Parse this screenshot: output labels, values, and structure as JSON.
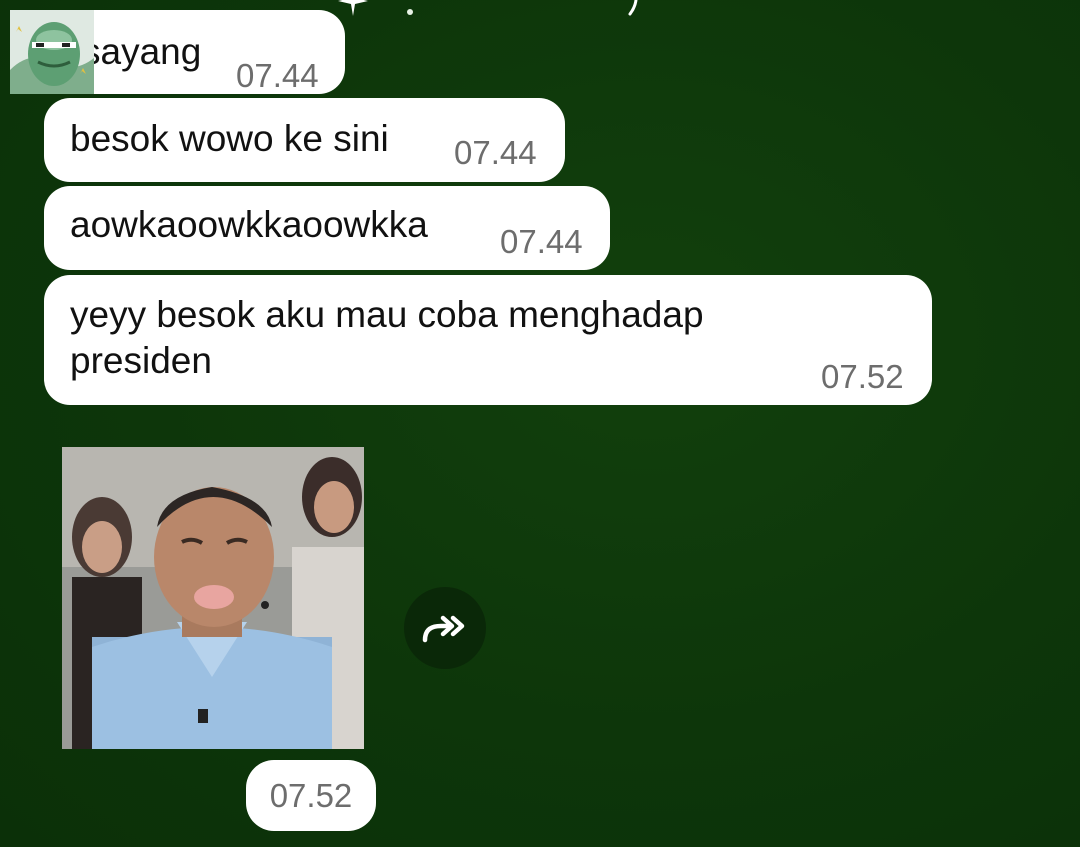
{
  "messages": [
    {
      "text": "sayang",
      "time": "07.44"
    },
    {
      "text": "besok wowo ke sini",
      "time": "07.44"
    },
    {
      "text": "aowkaoowkkaoowkka",
      "time": "07.44"
    },
    {
      "text": "yeyy besok aku mau coba menghadap presiden",
      "time": "07.52"
    }
  ],
  "media_message": {
    "time": "07.52",
    "forward_icon": "forward-double-arrow-icon"
  },
  "colors": {
    "background": "#0e3a0b",
    "bubble": "#ffffff",
    "timestamp": "#6d6d6d",
    "forward_button": "#0a2808"
  }
}
